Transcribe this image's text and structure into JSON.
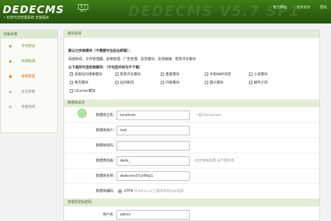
{
  "header": {
    "logo": "DEDECMS",
    "version": "5.7 SP1",
    "subtitle": "• 织梦内容管理系统 安装程序",
    "watermark": "DEDECMS V5.7 SP1",
    "links": [
      "官方网站",
      "技术论坛",
      "帮助"
    ]
  },
  "sidebar": {
    "title": "安装步骤",
    "steps": [
      {
        "label": "许可协议",
        "state": "done"
      },
      {
        "label": "环境检测",
        "state": "done"
      },
      {
        "label": "参数配置",
        "state": "active"
      },
      {
        "label": "正在安装",
        "state": "todo"
      },
      {
        "label": "安装完成",
        "state": "todo"
      }
    ]
  },
  "modules": {
    "title": "模块选择",
    "line1": "默认已安装模块（不需要可在后台卸载）：",
    "line2": "百度新闻、文件管理器、投稿管理、广告管理、投票模块、友情链接、帮意评论模块",
    "line3": "以下是所可选安装模块：（不勾选中的为不下载）",
    "items": [
      {
        "label": "百度站内搜索模块",
        "checked": true
      },
      {
        "label": "帮意评论模块",
        "checked": false
      },
      {
        "label": "重置模块",
        "checked": false
      },
      {
        "label": "手机WAP浏览",
        "checked": false
      },
      {
        "label": "小说模块",
        "checked": false
      },
      {
        "label": "黄页模块",
        "checked": false
      },
      {
        "label": "站内新闻",
        "checked": false
      },
      {
        "label": "问答模块",
        "checked": false
      },
      {
        "label": "圈子模块",
        "checked": false
      },
      {
        "label": "邮件订阅",
        "checked": false
      },
      {
        "label": "UCenter模块",
        "checked": false
      }
    ]
  },
  "database": {
    "title": "数据库设定",
    "rows": [
      {
        "label": "数据库主机：",
        "value": "localhost",
        "hint": "一般为localhost"
      },
      {
        "label": "数据库用户：",
        "value": "root",
        "hint": ""
      },
      {
        "label": "数据库密码：",
        "value": "",
        "hint": ""
      },
      {
        "label": "数据表前缀：",
        "value": "dede_",
        "hint": "如无特殊需要,请不要修改"
      },
      {
        "label": "数据库名称：",
        "value": "dedecms57utf8sp1",
        "hint": ""
      }
    ],
    "encoding_label": "数据库编码：",
    "encoding_value": "UTF8",
    "encoding_hint": "仅对4.1+以上版本的MySql选择"
  },
  "admin": {
    "title": "管理员初始密码",
    "user_label": "用户名：",
    "user_value": "admin"
  }
}
